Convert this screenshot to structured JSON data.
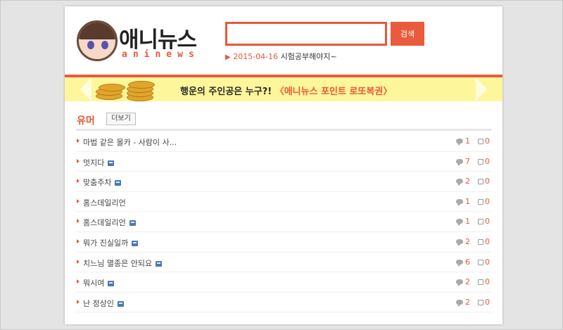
{
  "logo": {
    "title": "애니뉴스",
    "subtitle": "aninews"
  },
  "search": {
    "value": "",
    "placeholder": "",
    "button_label": "검색"
  },
  "notice": {
    "date": "2015-04-16",
    "text": "시험공부해야지~"
  },
  "banner": {
    "text": "행운의 주인공은 누구?!",
    "highlight": "〈애니뉴스 포인트 로또복권〉"
  },
  "section": {
    "title": "유머",
    "more_label": "더보기"
  },
  "posts": [
    {
      "title": "마법 같은 몰카 - 사람이 사...",
      "has_image": false,
      "comments": "1",
      "likes": "0"
    },
    {
      "title": "멋지다",
      "has_image": true,
      "comments": "7",
      "likes": "0"
    },
    {
      "title": "맞춤주차",
      "has_image": true,
      "comments": "2",
      "likes": "0"
    },
    {
      "title": "홈스데일리언",
      "has_image": false,
      "comments": "1",
      "likes": "0"
    },
    {
      "title": "홈스데일리언",
      "has_image": true,
      "comments": "1",
      "likes": "0"
    },
    {
      "title": "뭐가 진실일까",
      "has_image": true,
      "comments": "2",
      "likes": "0"
    },
    {
      "title": "치느님 멸종은 안되요",
      "has_image": true,
      "comments": "6",
      "likes": "0"
    },
    {
      "title": "뭐시여",
      "has_image": true,
      "comments": "2",
      "likes": "0"
    },
    {
      "title": "난 정상인",
      "has_image": true,
      "comments": "2",
      "likes": "0"
    }
  ],
  "colors": {
    "accent": "#e8583a",
    "banner_bg": "#fef69a",
    "page_bg": "#e4e4e4"
  }
}
